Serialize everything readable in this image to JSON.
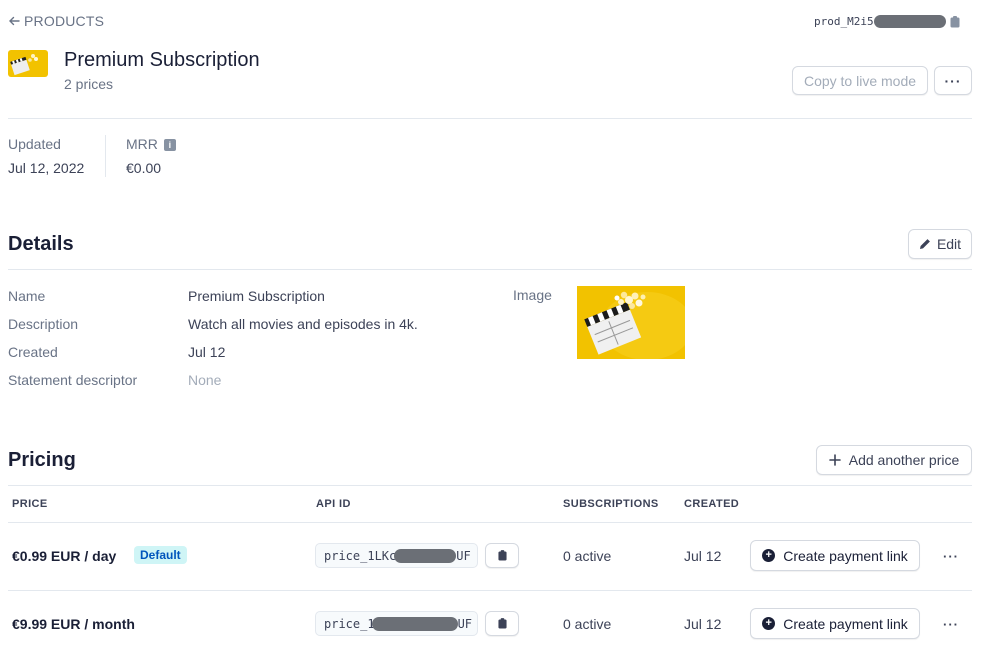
{
  "header": {
    "back_label": "PRODUCTS",
    "product_id_prefix": "prod_M2i5",
    "title": "Premium Subscription",
    "subtitle": "2 prices",
    "copy_live_label": "Copy to live mode",
    "more_label": "···"
  },
  "stats": {
    "updated_label": "Updated",
    "updated_value": "Jul 12, 2022",
    "mrr_label": "MRR",
    "mrr_value": "€0.00"
  },
  "details": {
    "heading": "Details",
    "edit_label": "Edit",
    "rows": [
      {
        "label": "Name",
        "value": "Premium Subscription"
      },
      {
        "label": "Description",
        "value": "Watch all movies and episodes in 4k."
      },
      {
        "label": "Created",
        "value": "Jul 12"
      },
      {
        "label": "Statement descriptor",
        "value": "None"
      }
    ],
    "image_label": "Image"
  },
  "pricing": {
    "heading": "Pricing",
    "add_label": "Add another price",
    "columns": [
      "PRICE",
      "API ID",
      "SUBSCRIPTIONS",
      "CREATED"
    ],
    "rows": [
      {
        "price": "€0.99 EUR / day",
        "badge": "Default",
        "api_prefix": "price_1LKc",
        "api_suffix": "UF",
        "subscriptions": "0 active",
        "created": "Jul 12",
        "link_label": "Create payment link",
        "more": "···"
      },
      {
        "price": "€9.99 EUR / month",
        "badge": "",
        "api_prefix": "price_1",
        "api_suffix": "UF",
        "subscriptions": "0 active",
        "created": "Jul 12",
        "link_label": "Create payment link",
        "more": "···"
      }
    ]
  },
  "colors": {
    "accent": "#635bff",
    "image_bg": "#f2c200",
    "badge_bg": "#cff5f6"
  },
  "icons": [
    "arrow-left-icon",
    "clipboard-icon",
    "info-icon",
    "pencil-icon",
    "plus-icon",
    "plus-circle-icon",
    "more-icon"
  ]
}
